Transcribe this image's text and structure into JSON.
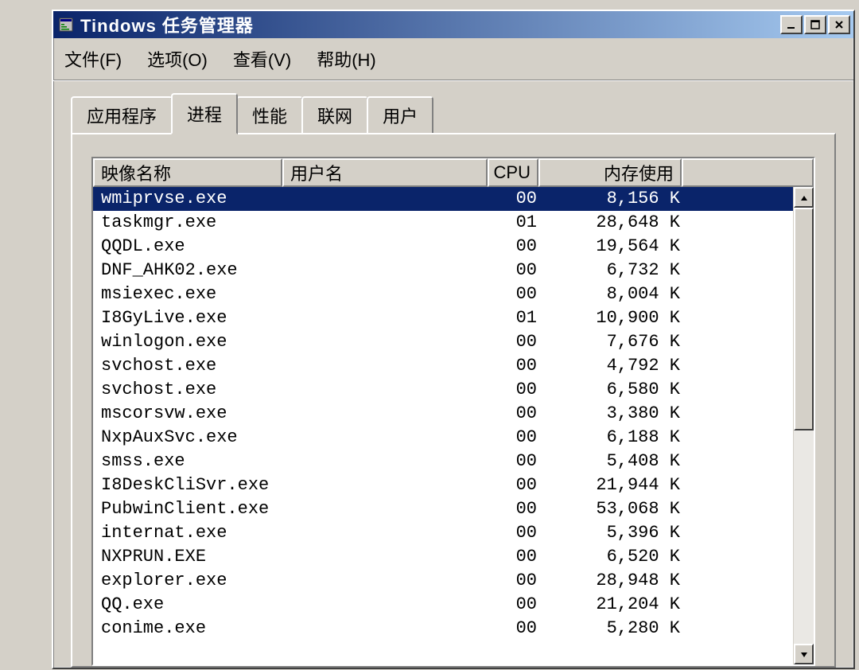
{
  "window": {
    "title": "Tindows 任务管理器"
  },
  "menu": {
    "file": "文件(F)",
    "options": "选项(O)",
    "view": "查看(V)",
    "help": "帮助(H)"
  },
  "tabs": {
    "applications": "应用程序",
    "processes": "进程",
    "performance": "性能",
    "networking": "联网",
    "users": "用户"
  },
  "columns": {
    "image_name": "映像名称",
    "user_name": "用户名",
    "cpu": "CPU",
    "mem_usage": "内存使用"
  },
  "processes": [
    {
      "name": "wmiprvse.exe",
      "user": "",
      "cpu": "00",
      "mem": "8,156 K",
      "selected": true
    },
    {
      "name": "taskmgr.exe",
      "user": "",
      "cpu": "01",
      "mem": "28,648 K",
      "selected": false
    },
    {
      "name": "QQDL.exe",
      "user": "",
      "cpu": "00",
      "mem": "19,564 K",
      "selected": false
    },
    {
      "name": "DNF_AHK02.exe",
      "user": "",
      "cpu": "00",
      "mem": "6,732 K",
      "selected": false
    },
    {
      "name": "msiexec.exe",
      "user": "",
      "cpu": "00",
      "mem": "8,004 K",
      "selected": false
    },
    {
      "name": "I8GyLive.exe",
      "user": "",
      "cpu": "01",
      "mem": "10,900 K",
      "selected": false
    },
    {
      "name": "winlogon.exe",
      "user": "",
      "cpu": "00",
      "mem": "7,676 K",
      "selected": false
    },
    {
      "name": "svchost.exe",
      "user": "",
      "cpu": "00",
      "mem": "4,792 K",
      "selected": false
    },
    {
      "name": "svchost.exe",
      "user": "",
      "cpu": "00",
      "mem": "6,580 K",
      "selected": false
    },
    {
      "name": "mscorsvw.exe",
      "user": "",
      "cpu": "00",
      "mem": "3,380 K",
      "selected": false
    },
    {
      "name": "NxpAuxSvc.exe",
      "user": "",
      "cpu": "00",
      "mem": "6,188 K",
      "selected": false
    },
    {
      "name": "smss.exe",
      "user": "",
      "cpu": "00",
      "mem": "5,408 K",
      "selected": false
    },
    {
      "name": "I8DeskCliSvr.exe",
      "user": "",
      "cpu": "00",
      "mem": "21,944 K",
      "selected": false
    },
    {
      "name": "PubwinClient.exe",
      "user": "",
      "cpu": "00",
      "mem": "53,068 K",
      "selected": false
    },
    {
      "name": "internat.exe",
      "user": "",
      "cpu": "00",
      "mem": "5,396 K",
      "selected": false
    },
    {
      "name": "NXPRUN.EXE",
      "user": "",
      "cpu": "00",
      "mem": "6,520 K",
      "selected": false
    },
    {
      "name": "explorer.exe",
      "user": "",
      "cpu": "00",
      "mem": "28,948 K",
      "selected": false
    },
    {
      "name": "QQ.exe",
      "user": "",
      "cpu": "00",
      "mem": "21,204 K",
      "selected": false
    },
    {
      "name": "conime.exe",
      "user": "",
      "cpu": "00",
      "mem": "5,280 K",
      "selected": false
    }
  ]
}
